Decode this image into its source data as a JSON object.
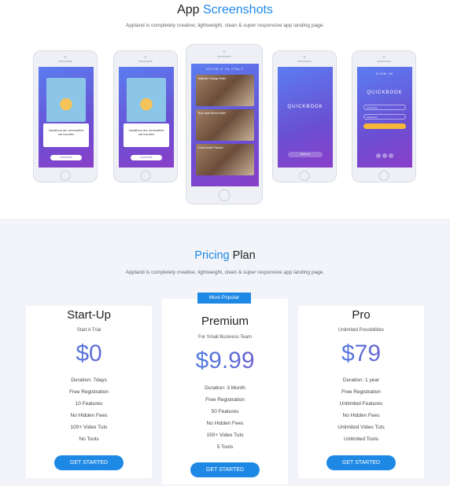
{
  "screenshots": {
    "title_plain": "App",
    "title_accent": "Screenshots",
    "subtitle": "Appland is completely creative, lightweight, clean & super responsive app landing page."
  },
  "phones": {
    "vacation_text": "Vacations are necessities\nnot luxuries",
    "continue_label": "CONTINUE",
    "hotels_header": "HOTELS IN ITALY",
    "hotels": [
      "Majestic Vintage Hotel",
      "Boa Vista Rimini Hotel",
      "Grand Hotel Firenze"
    ],
    "quickbook": "QUICKBOOK",
    "signup_label": "SIGN UP",
    "signin_header": "SIGN IN",
    "username_placeholder": "Username",
    "password_placeholder": "Password"
  },
  "pricing": {
    "title_accent": "Pricing",
    "title_plain": "Plan",
    "subtitle": "Appland is completely creative, lightweight, clean & super responsive app landing page.",
    "badge": "Most Popular",
    "plans": [
      {
        "name": "Start-Up",
        "tagline": "Start A Trial",
        "price": "$0",
        "features": [
          "Duration: 7days",
          "Free Registration",
          "10 Features",
          "No Hidden Fees",
          "100+ Video Tuts",
          "No Tools"
        ],
        "button": "GET STARTED"
      },
      {
        "name": "Premium",
        "tagline": "For Small Business Team",
        "price": "$9.99",
        "features": [
          "Duration: 3 Month",
          "Free Registration",
          "50 Features",
          "No Hidden Fees",
          "150+ Video Tuts",
          "5 Tools"
        ],
        "button": "GET STARTED"
      },
      {
        "name": "Pro",
        "tagline": "Unlimited Possibilities",
        "price": "$79",
        "features": [
          "Duration: 1 year",
          "Free Registration",
          "Unlimited Features",
          "No Hidden Fees",
          "Unlimited Video Tuts",
          "Unlimited Tools"
        ],
        "button": "GET STARTED"
      }
    ]
  },
  "colors": {
    "accent": "#1e88e5",
    "price_gradient_start": "#3f8ee8",
    "price_gradient_end": "#7b52c8",
    "section_bg": "#f2f4f9"
  }
}
